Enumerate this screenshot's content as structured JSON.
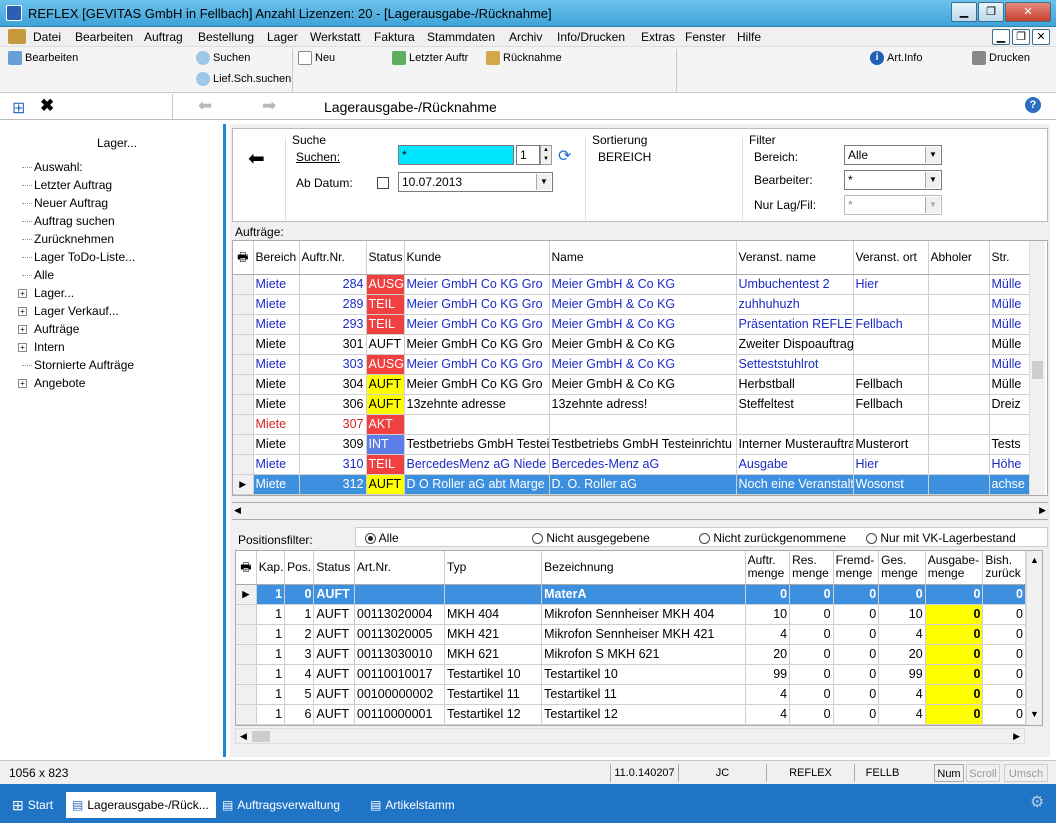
{
  "window": {
    "title": "REFLEX [GEVITAS GmbH in Fellbach] Anzahl Lizenzen: 20 - [Lagerausgabe-/Rücknahme]"
  },
  "menu": [
    "Datei",
    "Bearbeiten",
    "Auftrag",
    "Bestellung",
    "Lager",
    "Werkstatt",
    "Faktura",
    "Stammdaten",
    "Archiv",
    "Info/Drucken",
    "Extras",
    "Fenster",
    "Hilfe"
  ],
  "toolbar": {
    "bearbeiten": "Bearbeiten",
    "suchen": "Suchen",
    "liefsch": "Lief.Sch.suchen",
    "neu": "Neu",
    "letzter": "Letzter Auftr",
    "ruecknahme": "Rücknahme",
    "artinfo": "Art.Info",
    "drucken": "Drucken"
  },
  "nav": {
    "title": "Lagerausgabe-/Rücknahme"
  },
  "sidebar": {
    "header": "Lager...",
    "items": [
      {
        "label": "Auswahl:",
        "expand": false
      },
      {
        "label": "Letzter Auftrag",
        "expand": false
      },
      {
        "label": "Neuer Auftrag",
        "expand": false
      },
      {
        "label": "Auftrag suchen",
        "expand": false
      },
      {
        "label": "Zurücknehmen",
        "expand": false
      },
      {
        "label": "Lager ToDo-Liste...",
        "expand": false
      },
      {
        "label": "Alle",
        "expand": false
      },
      {
        "label": "Lager...",
        "expand": true
      },
      {
        "label": "Lager Verkauf...",
        "expand": true
      },
      {
        "label": "Aufträge",
        "expand": true
      },
      {
        "label": "Intern",
        "expand": true
      },
      {
        "label": "Stornierte Aufträge",
        "expand": false
      },
      {
        "label": "Angebote",
        "expand": true
      }
    ]
  },
  "search": {
    "group": "Suche",
    "suchen_label": "Suchen:",
    "suchen_value": "*",
    "count": "1",
    "datum_label": "Ab Datum:",
    "datum_value": "10.07.2013"
  },
  "sort": {
    "group": "Sortierung",
    "value": "BEREICH"
  },
  "filter": {
    "group": "Filter",
    "bereich_label": "Bereich:",
    "bereich_value": "Alle",
    "bearbeiter_label": "Bearbeiter:",
    "bearbeiter_value": "*",
    "lag_label": "Nur Lag/Fil:",
    "lag_value": "*"
  },
  "orders": {
    "label": "Aufträge:",
    "columns": [
      "Bereich",
      "Auftr.Nr.",
      "Status",
      "Kunde",
      "Name",
      "Veranst. name",
      "Veranst. ort",
      "Abholer",
      "Str."
    ],
    "rows": [
      {
        "bereich": "Miete",
        "nr": "284",
        "status": "AUSG",
        "kunde": "Meier GmbH  Co KG Gro",
        "name": "Meier GmbH & Co KG",
        "vname": "Umbuchentest 2",
        "vort": "Hier",
        "abholer": "",
        "str": "Mülle",
        "color": "blue",
        "sc": "#f04040",
        "sfc": "#fff"
      },
      {
        "bereich": "Miete",
        "nr": "289",
        "status": "TEIL",
        "kunde": "Meier GmbH  Co KG Gro",
        "name": "Meier GmbH & Co KG",
        "vname": "zuhhuhuzh",
        "vort": "",
        "abholer": "",
        "str": "Mülle",
        "color": "blue",
        "sc": "#f04040",
        "sfc": "#fff"
      },
      {
        "bereich": "Miete",
        "nr": "293",
        "status": "TEIL",
        "kunde": "Meier GmbH  Co KG Gro",
        "name": "Meier GmbH & Co KG",
        "vname": "Präsentation REFLEX",
        "vort": "Fellbach",
        "abholer": "",
        "str": "Mülle",
        "color": "blue",
        "sc": "#f04040",
        "sfc": "#fff"
      },
      {
        "bereich": "Miete",
        "nr": "301",
        "status": "AUFT",
        "kunde": "Meier GmbH  Co KG Gro",
        "name": "Meier GmbH & Co KG",
        "vname": "Zweiter Dispoauftrag",
        "vort": "",
        "abholer": "",
        "str": "Mülle",
        "color": "black",
        "sc": "",
        "sfc": "#000"
      },
      {
        "bereich": "Miete",
        "nr": "303",
        "status": "AUSG",
        "kunde": "Meier GmbH  Co KG Gro",
        "name": "Meier GmbH & Co KG",
        "vname": "Setteststuhlrot",
        "vort": "",
        "abholer": "",
        "str": "Mülle",
        "color": "blue",
        "sc": "#f04040",
        "sfc": "#fff"
      },
      {
        "bereich": "Miete",
        "nr": "304",
        "status": "AUFT",
        "kunde": "Meier GmbH  Co KG Gro",
        "name": "Meier GmbH & Co KG",
        "vname": "Herbstball",
        "vort": "Fellbach",
        "abholer": "",
        "str": "Mülle",
        "color": "black",
        "sc": "#ffff00",
        "sfc": "#000"
      },
      {
        "bereich": "Miete",
        "nr": "306",
        "status": "AUFT",
        "kunde": "13zehnte adresse",
        "name": "13zehnte adress!",
        "vname": "Steffeltest",
        "vort": "Fellbach",
        "abholer": "",
        "str": "Dreiz",
        "color": "black",
        "sc": "#ffff00",
        "sfc": "#000"
      },
      {
        "bereich": "Miete",
        "nr": "307",
        "status": "AKT",
        "kunde": "",
        "name": "",
        "vname": "",
        "vort": "",
        "abholer": "",
        "str": "",
        "color": "red",
        "sc": "#f04040",
        "sfc": "#fff"
      },
      {
        "bereich": "Miete",
        "nr": "309",
        "status": "INT",
        "kunde": "Testbetriebs GmbH Testei",
        "name": "Testbetriebs GmbH Testeinrichtu",
        "vname": "Interner Musterauftrag",
        "vort": "Musterort",
        "abholer": "",
        "str": "Tests",
        "color": "black",
        "sc": "#5a7de8",
        "sfc": "#fff"
      },
      {
        "bereich": "Miete",
        "nr": "310",
        "status": "TEIL",
        "kunde": "BercedesMenz aG Niede",
        "name": "Bercedes-Menz aG",
        "vname": "Ausgabe",
        "vort": "Hier",
        "abholer": "",
        "str": "Höhe",
        "color": "blue",
        "sc": "#f04040",
        "sfc": "#fff"
      },
      {
        "bereich": "Miete",
        "nr": "312",
        "status": "AUFT",
        "kunde": "D O Roller aG abt Marge",
        "name": "D. O. Roller aG",
        "vname": "Noch eine Veranstaltu",
        "vort": "Wosonst",
        "abholer": "",
        "str": "achse",
        "color": "sel",
        "sc": "#ffff00",
        "sfc": "#000"
      }
    ]
  },
  "posfilter": {
    "label": "Positionsfilter:",
    "options": [
      "Alle",
      "Nicht ausgegebene",
      "Nicht zurückgenommene",
      "Nur mit VK-Lagerbestand"
    ]
  },
  "positions": {
    "columns": [
      "Kap.",
      "Pos.",
      "Status",
      "Art.Nr.",
      "Typ",
      "Bezeichnung",
      "Auftr. menge",
      "Res. menge",
      "Fremd- menge",
      "Ges. menge",
      "Ausgabe- menge",
      "Bish. zurück"
    ],
    "header_row": {
      "kap": "1",
      "pos": "0",
      "status": "AUFT",
      "art": "",
      "typ": "",
      "bez": "MaterA",
      "auftr": "0",
      "res": "0",
      "fremd": "0",
      "ges": "0",
      "ausg": "0",
      "bish": "0"
    },
    "rows": [
      {
        "kap": "1",
        "pos": "1",
        "status": "AUFT",
        "art": "00113020004",
        "typ": "MKH 404",
        "bez": "Mikrofon Sennheiser MKH 404",
        "auftr": "10",
        "res": "0",
        "fremd": "0",
        "ges": "10",
        "ausg": "0",
        "bish": "0"
      },
      {
        "kap": "1",
        "pos": "2",
        "status": "AUFT",
        "art": "00113020005",
        "typ": "MKH 421",
        "bez": "Mikrofon Sennheiser MKH 421",
        "auftr": "4",
        "res": "0",
        "fremd": "0",
        "ges": "4",
        "ausg": "0",
        "bish": "0"
      },
      {
        "kap": "1",
        "pos": "3",
        "status": "AUFT",
        "art": "00113030010",
        "typ": "MKH 621",
        "bez": "Mikrofon S MKH 621",
        "auftr": "20",
        "res": "0",
        "fremd": "0",
        "ges": "20",
        "ausg": "0",
        "bish": "0"
      },
      {
        "kap": "1",
        "pos": "4",
        "status": "AUFT",
        "art": "00110010017",
        "typ": "Testartikel 10",
        "bez": "Testartikel 10",
        "auftr": "99",
        "res": "0",
        "fremd": "0",
        "ges": "99",
        "ausg": "0",
        "bish": "0"
      },
      {
        "kap": "1",
        "pos": "5",
        "status": "AUFT",
        "art": "00100000002",
        "typ": "Testartikel 11",
        "bez": "Testartikel 11",
        "auftr": "4",
        "res": "0",
        "fremd": "0",
        "ges": "4",
        "ausg": "0",
        "bish": "0"
      },
      {
        "kap": "1",
        "pos": "6",
        "status": "AUFT",
        "art": "00110000001",
        "typ": "Testartikel 12",
        "bez": "Testartikel 12",
        "auftr": "4",
        "res": "0",
        "fremd": "0",
        "ges": "4",
        "ausg": "0",
        "bish": "0"
      }
    ]
  },
  "status": {
    "size": "1056 x 823",
    "version": "11.0.140207",
    "user": "JC",
    "app": "REFLEX",
    "site": "FELLB",
    "num": "Num",
    "scroll": "Scroll",
    "umsch": "Umsch"
  },
  "taskbar": {
    "start": "Start",
    "tasks": [
      "Lagerausgabe-/Rück...",
      "Auftragsverwaltung",
      "Artikelstamm"
    ]
  }
}
